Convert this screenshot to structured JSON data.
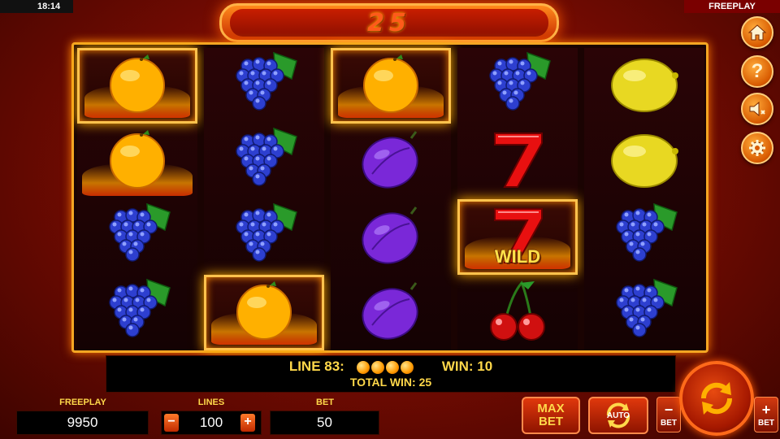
{
  "status": {
    "clock": "18:14",
    "mode": "FREEPLAY"
  },
  "win_banner": {
    "amount": "25"
  },
  "reels": [
    [
      "orange",
      "orange",
      "grapes",
      "grapes"
    ],
    [
      "grapes",
      "grapes",
      "grapes",
      "orange"
    ],
    [
      "orange",
      "plum",
      "plum",
      "plum"
    ],
    [
      "grapes",
      "seven",
      "seven-wild",
      "cherries"
    ],
    [
      "lemon",
      "lemon",
      "grapes",
      "grapes"
    ]
  ],
  "winning_cells": [
    [
      0,
      0
    ],
    [
      1,
      3
    ],
    [
      2,
      0
    ],
    [
      3,
      2
    ]
  ],
  "wild_label": "WILD",
  "info": {
    "line_label": "LINE 83:",
    "line_symbol_count": 4,
    "win_label": "WIN: 10",
    "total_label": "TOTAL WIN: 25"
  },
  "bottom": {
    "freeplay_label": "FREEPLAY",
    "freeplay_value": "9950",
    "lines_label": "LINES",
    "lines_value": "100",
    "bet_label": "BET",
    "bet_value": "50",
    "minus": "−",
    "plus": "+",
    "max_bet_line1": "MAX",
    "max_bet_line2": "BET",
    "auto_label": "AUTO",
    "bet_minus_label": "BET",
    "bet_plus_label": "BET"
  },
  "side_buttons": [
    "home-icon",
    "help-icon",
    "sound-off-icon",
    "settings-icon"
  ],
  "side_button_glyphs": {
    "help": "?"
  },
  "colors": {
    "accent": "#ffd84a",
    "frame": "#f5a623",
    "banner_text": "#ff5a1a"
  }
}
